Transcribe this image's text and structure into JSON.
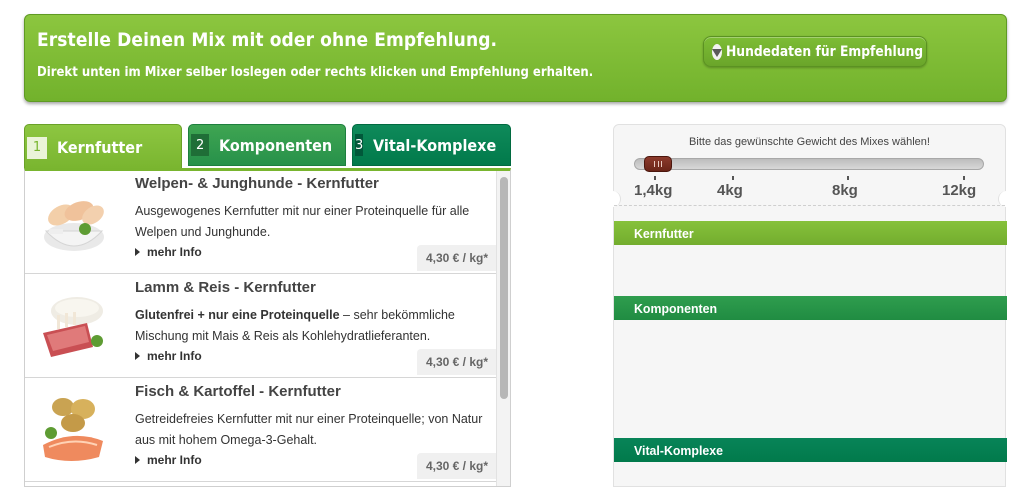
{
  "banner": {
    "title": "Erstelle Deinen Mix mit oder ohne Empfehlung.",
    "subtitle": "Direkt unten im Mixer selber loslegen oder rechts klicken und Empfehlung erhalten.",
    "recommend_button": "Hundedaten für Empfehlung"
  },
  "tabs": [
    {
      "num": "1",
      "label": "Kernfutter"
    },
    {
      "num": "2",
      "label": "Komponenten"
    },
    {
      "num": "3",
      "label": "Vital-Komplexe"
    }
  ],
  "products": [
    {
      "title": "Welpen- & Junghunde - Kernfutter",
      "desc_plain": "Ausgewogenes Kernfutter mit nur einer Proteinquelle für alle Welpen und Junghunde.",
      "more": "mehr Info",
      "price": "4,30 € / kg*"
    },
    {
      "title": "Lamm & Reis - Kernfutter",
      "desc_bold": "Glutenfrei + nur eine Proteinquelle",
      "desc_plain": " – sehr bekömmliche Mischung mit Mais & Reis als Kohlehydratlieferanten.",
      "more": "mehr Info",
      "price": "4,30 € / kg*"
    },
    {
      "title": "Fisch & Kartoffel - Kernfutter",
      "desc_plain": "Getreidefreies Kernfutter mit nur einer Proteinquelle; von Natur aus mit hohem Omega-3-Gehalt.",
      "more": "mehr Info",
      "price": "4,30 € / kg*"
    }
  ],
  "mixer": {
    "hint": "Bitte das gewünschte Gewicht des Mixes wählen!",
    "weights": [
      "1,4kg",
      "4kg",
      "8kg",
      "12kg"
    ],
    "selected_weight": "1,4kg",
    "sections": [
      "Kernfutter",
      "Komponenten",
      "Vital-Komplexe"
    ]
  },
  "colors": {
    "kernfutter": "#79b52f",
    "komponenten": "#27914a",
    "vital": "#017a4b",
    "slider_handle": "#7a2d1f"
  }
}
